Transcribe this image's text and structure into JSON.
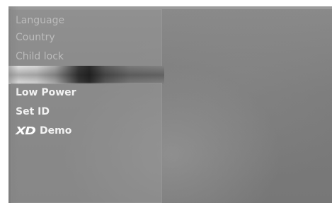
{
  "menu": {
    "upper_items": [
      {
        "label": "Language"
      },
      {
        "label": "Country"
      },
      {
        "label": "Child lock"
      }
    ],
    "lower_items": [
      {
        "label": "Low Power"
      },
      {
        "label": "Set ID"
      },
      {
        "label": "Demo",
        "logo_text": "XD"
      }
    ]
  },
  "colors": {
    "screen_background": "#7c7c7c",
    "selector_highlight": "#e8e8e8",
    "dim_text": "#bcbcbc",
    "bright_text": "#f2f2f2"
  }
}
